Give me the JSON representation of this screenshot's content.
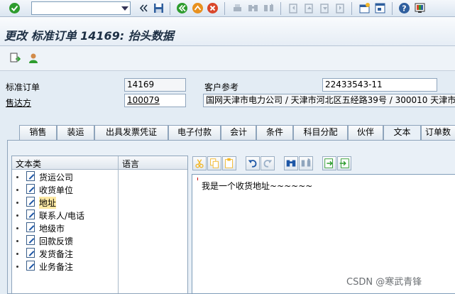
{
  "toolbar": {
    "command_value": "",
    "icons": [
      "check-icon",
      "save-icon",
      "back-icon",
      "exit-icon",
      "cancel-icon",
      "print-icon",
      "find-icon",
      "find-next-icon",
      "first-page-icon",
      "previous-page-icon",
      "next-page-icon",
      "last-page-icon",
      "create-session-icon",
      "shortcut-icon",
      "help-icon",
      "customize-layout-icon"
    ]
  },
  "title": "更改 标准订单 14169: 抬头数据",
  "header": {
    "order_label": "标准订单",
    "order_value": "14169",
    "customer_ref_label": "客户参考",
    "customer_ref_value": "22433543-11",
    "soldto_label": "售达方",
    "soldto_value": "100079",
    "soldto_address": "国网天津市电力公司 / 天津市河北区五经路39号 / 300010 天津市"
  },
  "tabs": [
    {
      "label": "销售"
    },
    {
      "label": "装运"
    },
    {
      "label": "出具发票凭证"
    },
    {
      "label": "电子付款"
    },
    {
      "label": "会计"
    },
    {
      "label": "条件"
    },
    {
      "label": "科目分配"
    },
    {
      "label": "伙伴"
    },
    {
      "label": "文本"
    },
    {
      "label": "订单数"
    }
  ],
  "tree": {
    "col_text_type": "文本类",
    "col_language": "语言",
    "items": [
      {
        "label": "货运公司"
      },
      {
        "label": "收货单位"
      },
      {
        "label": "地址"
      },
      {
        "label": "联系人/电话"
      },
      {
        "label": "地级市"
      },
      {
        "label": "回款反馈"
      },
      {
        "label": "发货备注"
      },
      {
        "label": "业务备注"
      }
    ]
  },
  "editor": {
    "text": "我是一个收货地址~~~~~~"
  },
  "watermark": "CSDN @寒武青锋",
  "colors": {
    "accent": "#1c56a6",
    "selected": "#fde9a4",
    "check_green": "#2e9c2e",
    "cancel_red": "#d9472b"
  }
}
